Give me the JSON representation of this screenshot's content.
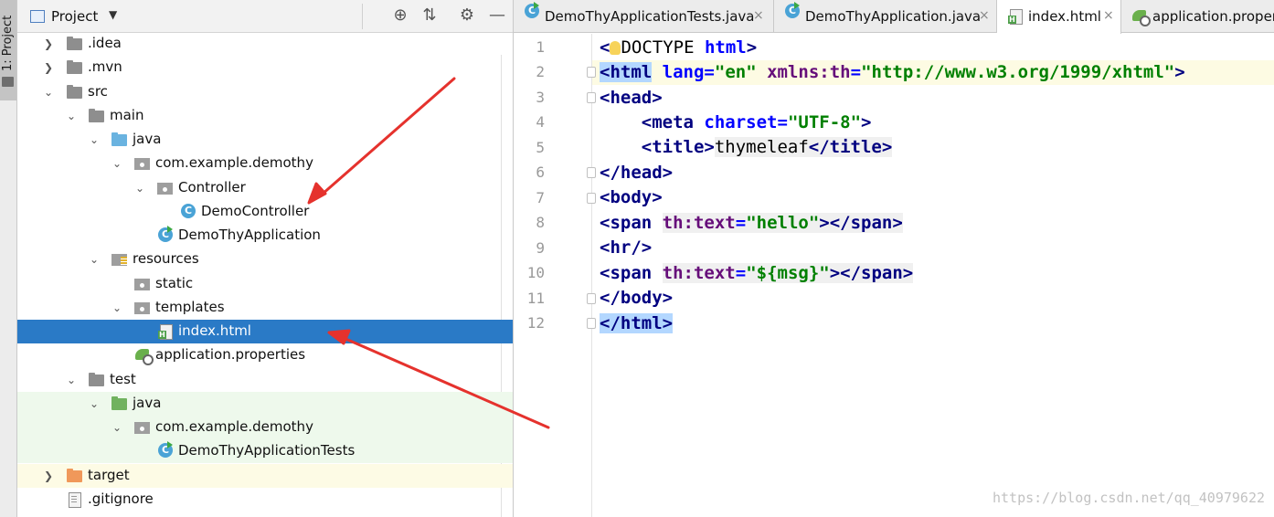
{
  "tool_stripe": {
    "label": "1: Project"
  },
  "panel": {
    "title": "Project",
    "tools": [
      "locate-icon",
      "collapse-icon",
      "gear-icon",
      "minimize-icon"
    ]
  },
  "tree": [
    {
      "label": ".idea",
      "expanded": false,
      "icon": "folder-icon"
    },
    {
      "label": ".mvn",
      "expanded": false,
      "icon": "folder-icon"
    },
    {
      "label": "src",
      "expanded": true,
      "icon": "folder-icon"
    },
    {
      "label": "main",
      "expanded": true,
      "icon": "folder-icon"
    },
    {
      "label": "java",
      "expanded": true,
      "icon": "source-folder-icon"
    },
    {
      "label": "com.example.demothy",
      "expanded": true,
      "icon": "package-icon"
    },
    {
      "label": "Controller",
      "expanded": true,
      "icon": "package-icon"
    },
    {
      "label": "DemoController",
      "icon": "class-icon"
    },
    {
      "label": "DemoThyApplication",
      "icon": "spring-boot-class-icon"
    },
    {
      "label": "resources",
      "expanded": true,
      "icon": "resources-folder-icon"
    },
    {
      "label": "static",
      "icon": "package-icon"
    },
    {
      "label": "templates",
      "expanded": true,
      "icon": "package-icon"
    },
    {
      "label": "index.html",
      "icon": "html-file-icon",
      "selected": true
    },
    {
      "label": "application.properties",
      "icon": "spring-properties-icon"
    },
    {
      "label": "test",
      "expanded": true,
      "icon": "folder-icon"
    },
    {
      "label": "java",
      "expanded": true,
      "icon": "test-folder-icon"
    },
    {
      "label": "com.example.demothy",
      "expanded": true,
      "icon": "package-icon"
    },
    {
      "label": "DemoThyApplicationTests",
      "icon": "spring-boot-class-icon"
    },
    {
      "label": "target",
      "expanded": false,
      "icon": "excluded-folder-icon"
    },
    {
      "label": ".gitignore",
      "icon": "text-file-icon"
    }
  ],
  "tabs": [
    {
      "label": "DemoThyApplicationTests.java",
      "close": "×",
      "active": false
    },
    {
      "label": "DemoThyApplication.java",
      "close": "×",
      "active": false
    },
    {
      "label": "index.html",
      "close": "×",
      "active": true
    },
    {
      "label": "application.proper",
      "active": false
    }
  ],
  "editor": {
    "line_numbers": [
      "1",
      "2",
      "3",
      "4",
      "5",
      "6",
      "7",
      "8",
      "9",
      "10",
      "11",
      "12"
    ],
    "code": {
      "l1_a": "<",
      "l1_b": "DOCTYPE ",
      "l1_c": "html",
      "l1_d": ">",
      "l2_open": "<html",
      "l2_sp1": " ",
      "l2_attr1": "lang",
      "l2_eq1": "=",
      "l2_val1": "\"en\"",
      "l2_sp2": " ",
      "l2_attr2": "xmlns:th",
      "l2_eq2": "=",
      "l2_val2": "\"http://www.w3.org/1999/xhtml\"",
      "l2_close": ">",
      "l3": "<head>",
      "l4_indent": "    ",
      "l4_open": "<meta",
      "l4_sp": " ",
      "l4_attr": "charset",
      "l4_eq": "=",
      "l4_val": "\"UTF-8\"",
      "l4_close": ">",
      "l5_indent": "    ",
      "l5_open": "<title>",
      "l5_text": "thymeleaf",
      "l5_close": "</title>",
      "l6": "</head>",
      "l7": "<body>",
      "l8_open": "<span",
      "l8_sp": " ",
      "l8_attr": "th:text",
      "l8_eq": "=",
      "l8_val": "\"hello\"",
      "l8_close": "></span>",
      "l9": "<hr/>",
      "l10_open": "<span",
      "l10_sp": " ",
      "l10_attr": "th:text",
      "l10_eq": "=",
      "l10_val": "\"${msg}\"",
      "l10_close": "></span>",
      "l11": "</body>",
      "l12": "</html>"
    }
  },
  "watermark": "https://blog.csdn.net/qq_40979622",
  "colors": {
    "selection": "#2a7ac6",
    "tag": "#000080",
    "attribute": "#0000ff",
    "string": "#008000",
    "arrow": "#e5322d"
  }
}
